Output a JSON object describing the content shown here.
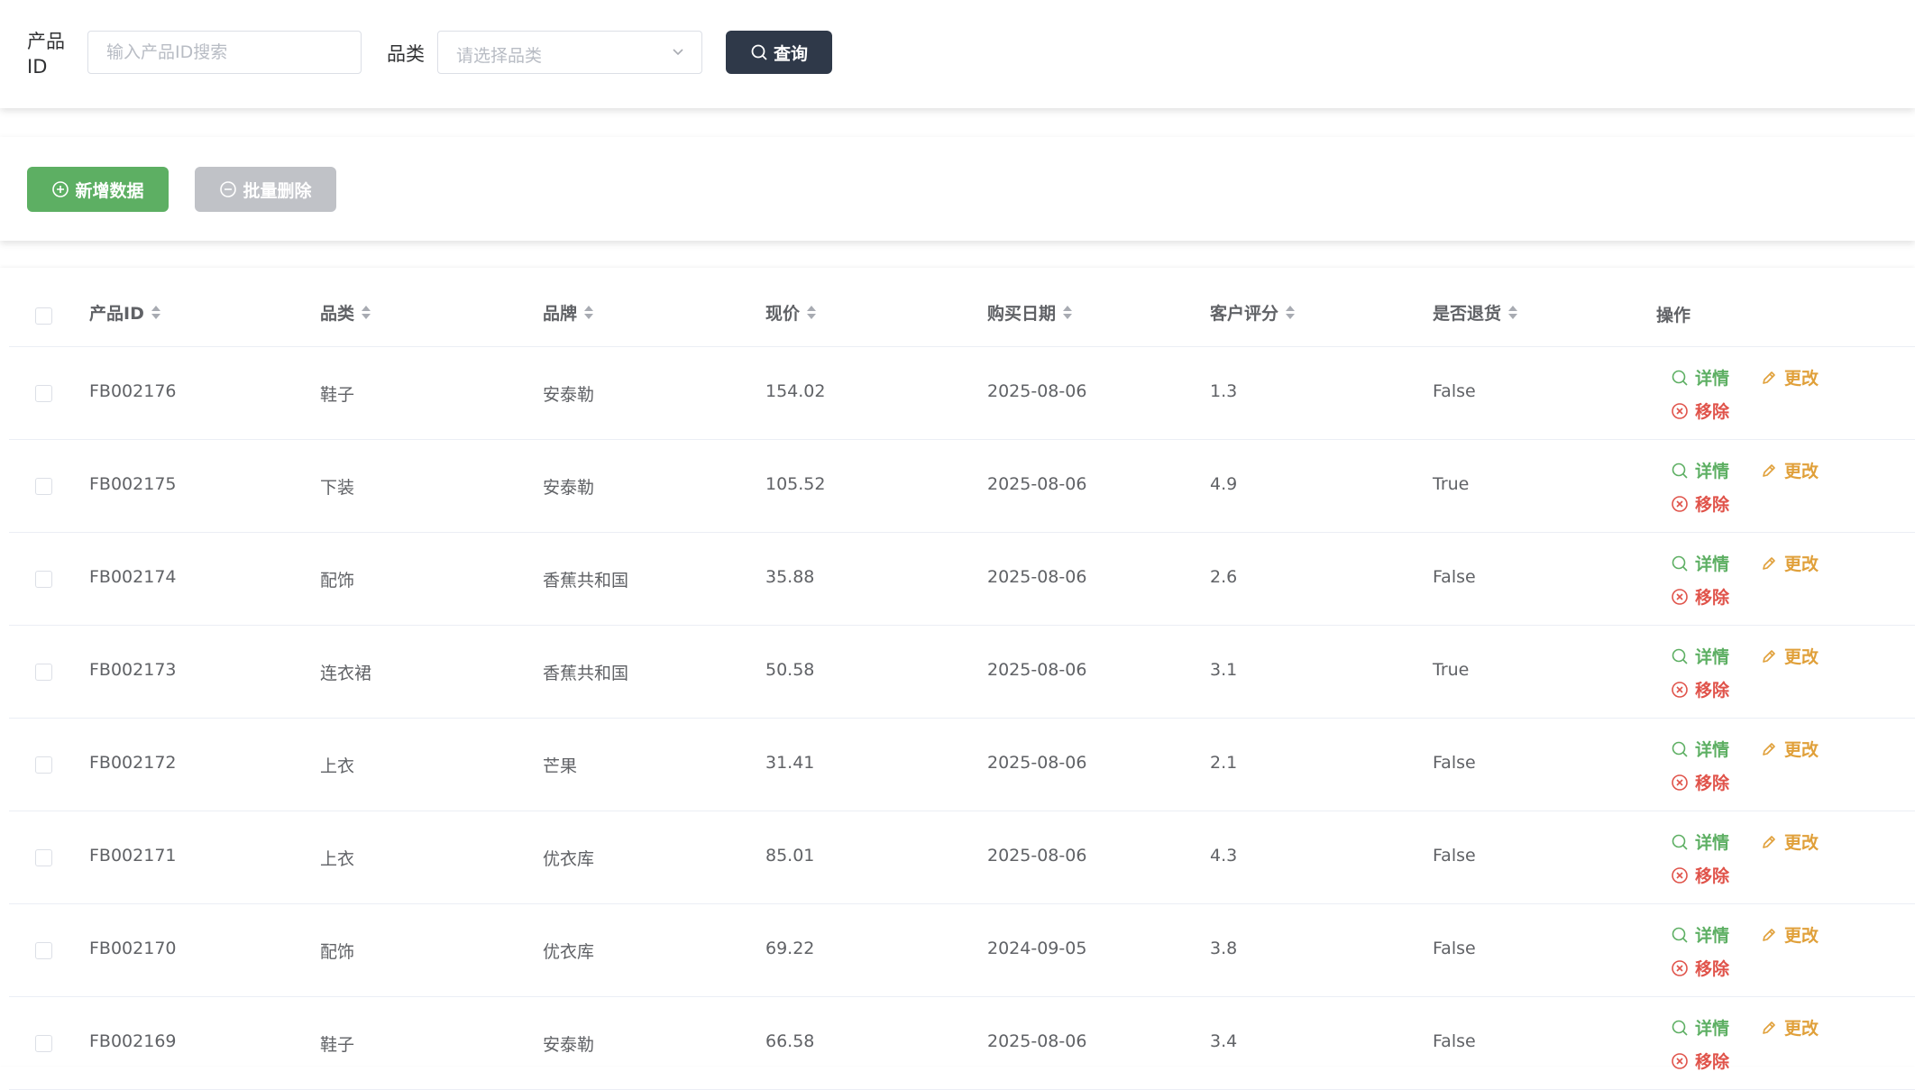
{
  "search": {
    "pid_label": "产品ID",
    "pid_placeholder": "输入产品ID搜索",
    "category_label": "品类",
    "category_placeholder": "请选择品类",
    "query_label": "查询"
  },
  "toolbar": {
    "add_label": "新增数据",
    "batch_delete_label": "批量删除"
  },
  "table": {
    "columns": [
      "产品ID",
      "品类",
      "品牌",
      "现价",
      "购买日期",
      "客户评分",
      "是否退货",
      "操作"
    ],
    "actions": {
      "detail": "详情",
      "edit": "更改",
      "remove": "移除"
    },
    "rows": [
      [
        "FB002176",
        "鞋子",
        "安泰勒",
        "154.02",
        "2025-08-06",
        "1.3",
        "False"
      ],
      [
        "FB002175",
        "下装",
        "安泰勒",
        "105.52",
        "2025-08-06",
        "4.9",
        "True"
      ],
      [
        "FB002174",
        "配饰",
        "香蕉共和国",
        "35.88",
        "2025-08-06",
        "2.6",
        "False"
      ],
      [
        "FB002173",
        "连衣裙",
        "香蕉共和国",
        "50.58",
        "2025-08-06",
        "3.1",
        "True"
      ],
      [
        "FB002172",
        "上衣",
        "芒果",
        "31.41",
        "2025-08-06",
        "2.1",
        "False"
      ],
      [
        "FB002171",
        "上衣",
        "优衣库",
        "85.01",
        "2025-08-06",
        "4.3",
        "False"
      ],
      [
        "FB002170",
        "配饰",
        "优衣库",
        "69.22",
        "2024-09-05",
        "3.8",
        "False"
      ],
      [
        "FB002169",
        "鞋子",
        "安泰勒",
        "66.58",
        "2025-08-06",
        "3.4",
        "False"
      ]
    ]
  },
  "colors": {
    "primary_dark": "#2f3949",
    "success": "#5daf63",
    "warning": "#e0a03a",
    "danger": "#e0534a",
    "disabled": "#c0c2c7"
  },
  "icons": {
    "query": "search-icon",
    "add": "plus-circle-icon",
    "batch_delete": "minus-circle-icon",
    "detail": "search-icon",
    "edit": "pencil-icon",
    "remove": "close-circle-icon",
    "select": "chevron-down-icon"
  }
}
